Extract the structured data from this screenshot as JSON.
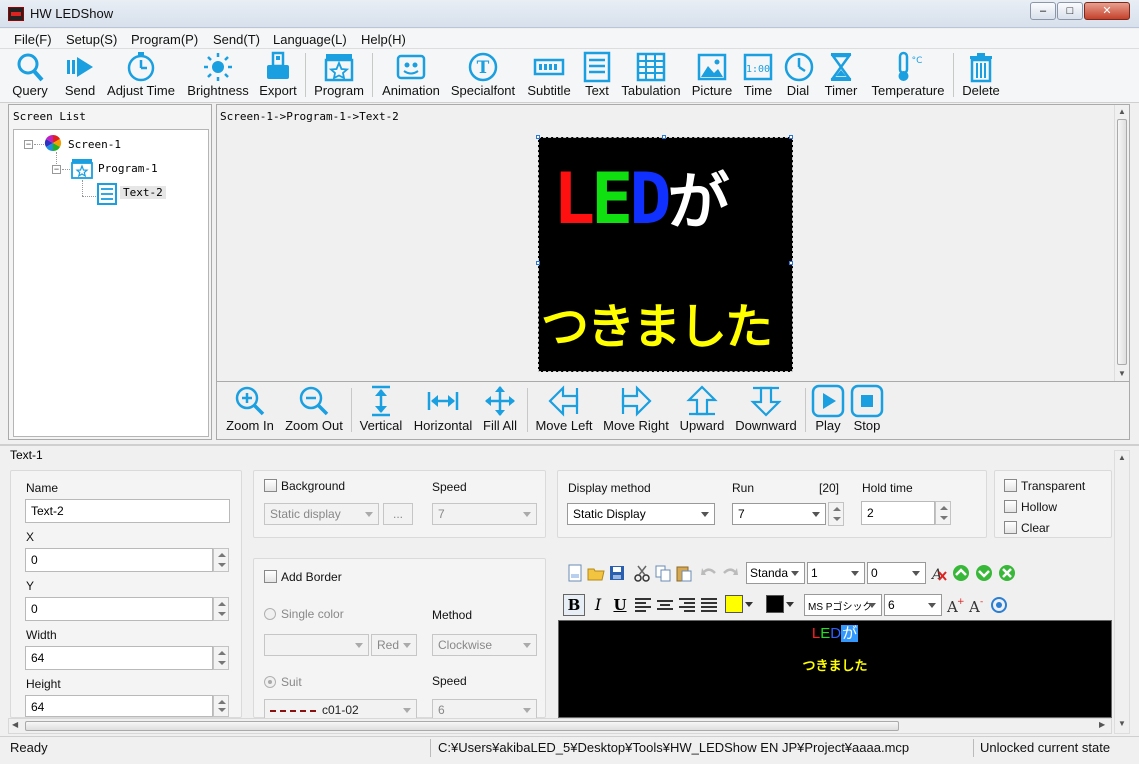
{
  "window": {
    "title": "HW LEDShow"
  },
  "menu": [
    "File(F)",
    "Setup(S)",
    "Program(P)",
    "Send(T)",
    "Language(L)",
    "Help(H)"
  ],
  "toolbar": {
    "query": "Query",
    "send": "Send",
    "adjust_time": "Adjust Time",
    "brightness": "Brightness",
    "export": "Export",
    "program": "Program",
    "animation": "Animation",
    "specialfont": "Specialfont",
    "subtitle": "Subtitle",
    "text": "Text",
    "tabulation": "Tabulation",
    "picture": "Picture",
    "time": "Time",
    "dial": "Dial",
    "timer": "Timer",
    "temperature": "Temperature",
    "delete": "Delete",
    "time_icon_text": "1:00",
    "temperature_icon_text": "°C"
  },
  "screen_list": {
    "header": "Screen List",
    "tree": [
      {
        "label": "Screen-1",
        "expander": "−"
      },
      {
        "label": "Program-1",
        "expander": "−"
      },
      {
        "label": "Text-2"
      }
    ]
  },
  "preview": {
    "breadcrumb": "Screen-1->Program-1->Text-2",
    "line1": [
      "L",
      "E",
      "D",
      "が"
    ],
    "line1_colors": [
      "#ff1010",
      "#10e010",
      "#1030ff",
      "#ffffff"
    ],
    "line2": "つきました",
    "line2_color": "#ffff00"
  },
  "zoombar": {
    "zoom_in": "Zoom In",
    "zoom_out": "Zoom Out",
    "vertical": "Vertical",
    "horizontal": "Horizontal",
    "fill_all": "Fill All",
    "move_left": "Move Left",
    "move_right": "Move Right",
    "upward": "Upward",
    "downward": "Downward",
    "play": "Play",
    "stop": "Stop"
  },
  "props": {
    "title": "Text-1",
    "name_label": "Name",
    "name_value": "Text-2",
    "x_label": "X",
    "x_value": "0",
    "y_label": "Y",
    "y_value": "0",
    "width_label": "Width",
    "width_value": "64",
    "height_label": "Height",
    "height_value": "64",
    "background_label": "Background",
    "background_value": "Static display",
    "browse": "...",
    "speed_label": "Speed",
    "speed_value": "7",
    "add_border_label": "Add Border",
    "single_color_label": "Single color",
    "single_color_value": "",
    "color_value": "Red",
    "method_label": "Method",
    "method_value": "Clockwise",
    "suit_label": "Suit",
    "suit_value": "c01-02",
    "speed2_label": "Speed",
    "speed2_value": "6",
    "display_method_label": "Display method",
    "display_method_value": "Static Display",
    "run_label": "Run",
    "run_count": "[20]",
    "run_value": "7",
    "hold_time_label": "Hold time",
    "hold_time_value": "2",
    "transparent_label": "Transparent",
    "hollow_label": "Hollow",
    "clear_label": "Clear"
  },
  "editor": {
    "font_style": "Standa",
    "line_spacing": "1",
    "char_spacing": "0",
    "bold": "B",
    "italic": "I",
    "underline": "U",
    "font_name": "MS Pゴシック",
    "font_size": "6",
    "line1": [
      "L",
      "E",
      "D",
      "が"
    ],
    "line1_colors": [
      "#ff2020",
      "#20e020",
      "#3060ff",
      "#ffffff"
    ],
    "line2": "つきました",
    "line2_color": "#ffff00",
    "selection_color": "#3399ff"
  },
  "status": {
    "ready": "Ready",
    "path": "C:¥Users¥akibaLED_5¥Desktop¥Tools¥HW_LEDShow EN JP¥Project¥aaaa.mcp",
    "state": "Unlocked current state"
  },
  "colors": {
    "icon_blue": "#1a9fe0",
    "led_bg": "#000000"
  }
}
